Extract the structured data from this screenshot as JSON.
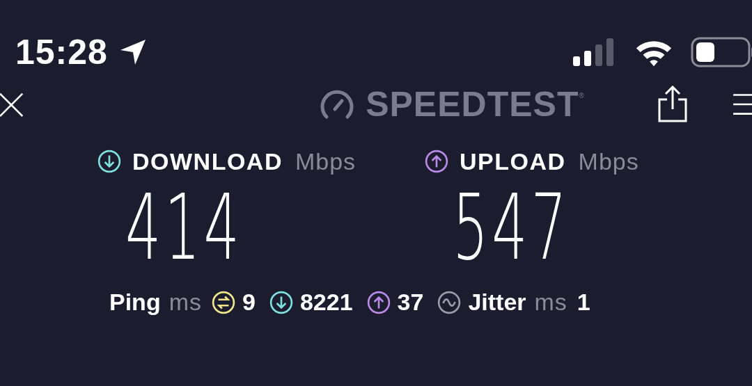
{
  "status_bar": {
    "time": "15:28"
  },
  "header": {
    "logo": "SPEEDTEST",
    "trademark": "®"
  },
  "results": [
    {
      "kind": "download",
      "label": "DOWNLOAD",
      "unit": "Mbps",
      "value": "414",
      "color": "#7fe0e0"
    },
    {
      "kind": "upload",
      "label": "UPLOAD",
      "unit": "Mbps",
      "value": "547",
      "color": "#b98ae8"
    }
  ],
  "ping": {
    "label": "Ping",
    "unit": "ms",
    "idle": "9",
    "download": "8221",
    "upload": "37"
  },
  "jitter": {
    "label": "Jitter",
    "unit": "ms",
    "value": "1"
  }
}
